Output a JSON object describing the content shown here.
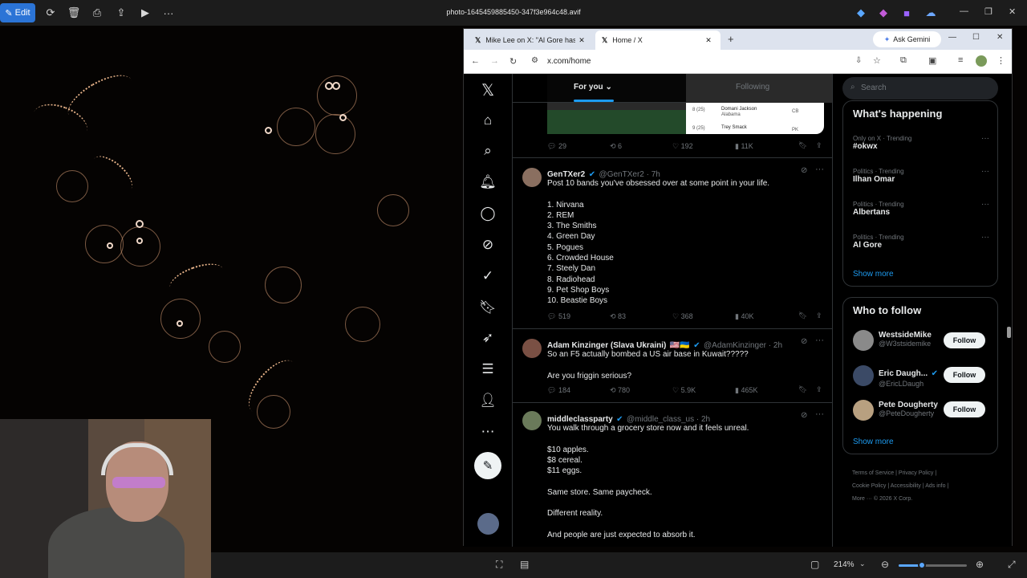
{
  "viewer": {
    "edit_label": "Edit",
    "file_title": "photo-1645459885450-347f3e964c48.avif",
    "zoom": "214%"
  },
  "browser": {
    "tabs": [
      {
        "label": "Mike Lee on X: \"Al Gore has cal"
      },
      {
        "label": "Home / X"
      }
    ],
    "gemini_label": "Ask Gemini",
    "url": "x.com/home"
  },
  "feed_tabs": {
    "for_you": "For you",
    "following": "Following"
  },
  "prev_tweet": {
    "replies": "29",
    "reposts": "6",
    "likes": "192",
    "views": "11K",
    "embed_rows": [
      {
        "a": "Domani Jackson",
        "b": "Alabama",
        "c": "CB"
      },
      {
        "a": "Trey Smack",
        "b": "",
        "c": "PK"
      }
    ]
  },
  "tweets": [
    {
      "name": "GenTXer2",
      "handle": "@GenTXer2 · 7h",
      "text": "Post 10 bands you've obsessed over at some point in your life.\n\n1. Nirvana\n2. REM\n3. The Smiths\n4. Green Day\n5. Pogues\n6. Crowded House\n7. Steely Dan\n8. Radiohead\n9. Pet Shop Boys\n10. Beastie Boys",
      "replies": "519",
      "reposts": "83",
      "likes": "368",
      "views": "40K"
    },
    {
      "name": "Adam Kinzinger (Slava Ukraini)",
      "flags": "🇺🇸🇺🇦",
      "handle": "@AdamKinzinger · 2h",
      "text": "So an F5 actually bombed a US air base in Kuwait?????\n\nAre you friggin serious?",
      "replies": "184",
      "reposts": "780",
      "likes": "5.9K",
      "views": "465K"
    },
    {
      "name": "middleclassparty",
      "handle": "@middle_class_us · 2h",
      "text": "You walk through a grocery store now and it feels unreal.\n\n$10 apples.\n$8 cereal.\n$11 eggs.\n\nSame store. Same paycheck.\n\nDifferent reality.\n\nAnd people are just expected to absorb it."
    }
  ],
  "sidebar": {
    "search_placeholder": "Search",
    "happening_title": "What's happening",
    "trends": [
      {
        "meta": "Only on X · Trending",
        "name": "#okwx"
      },
      {
        "meta": "Politics · Trending",
        "name": "Ilhan Omar"
      },
      {
        "meta": "Politics · Trending",
        "name": "Albertans"
      },
      {
        "meta": "Politics · Trending",
        "name": "Al Gore"
      }
    ],
    "show_more": "Show more",
    "wtf_title": "Who to follow",
    "follow_label": "Follow",
    "people": [
      {
        "name": "WestsideMike",
        "handle": "@W3stsidemike"
      },
      {
        "name": "Eric Daugh...",
        "handle": "@EricLDaugh"
      },
      {
        "name": "Pete Dougherty",
        "handle": "@PeteDougherty"
      }
    ],
    "footer": {
      "terms": "Terms of Service",
      "privacy": "Privacy Policy",
      "cookie": "Cookie Policy",
      "accessibility": "Accessibility",
      "ads": "Ads info",
      "more": "More ···",
      "copyright": "© 2026 X Corp."
    }
  }
}
